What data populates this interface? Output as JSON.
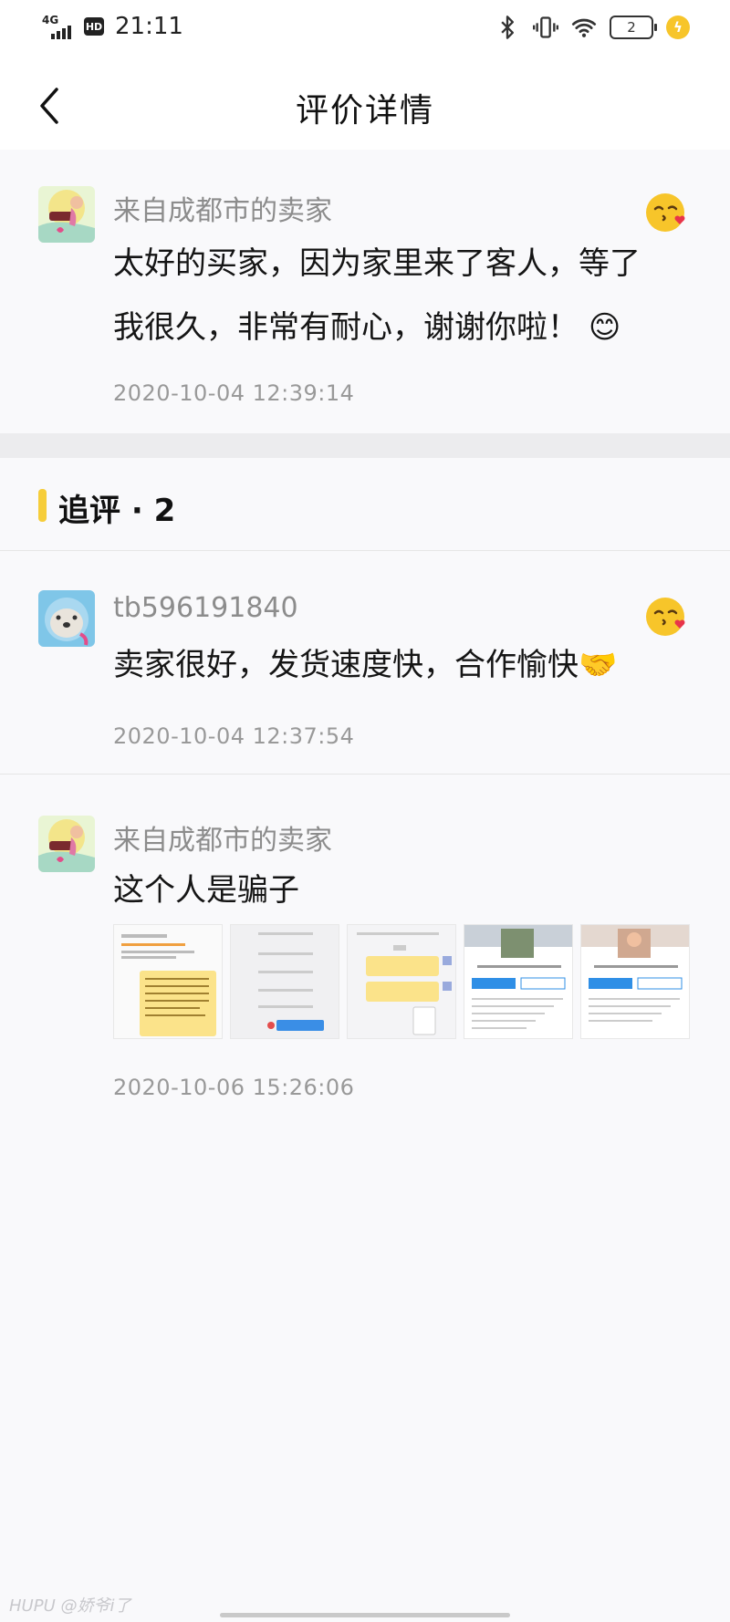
{
  "status_bar": {
    "network": "4G",
    "hd_label": "HD",
    "time": "21:11",
    "battery_level": "2",
    "icons": [
      "signal-icon",
      "bluetooth-icon",
      "vibrate-icon",
      "wifi-icon",
      "battery-icon",
      "charging-icon"
    ]
  },
  "header": {
    "back_icon": "chevron-left-icon",
    "title": "评价详情"
  },
  "main_review": {
    "author": "来自成都市的卖家",
    "content_line1": "太好的买家，因为家里来了客人，等了",
    "content_line2": "我很久，非常有耐心，谢谢你啦！",
    "content_emoji": "😊",
    "timestamp": "2020-10-04 12:39:14",
    "reaction_icon": "kiss-wink-emoji-icon"
  },
  "follow_up": {
    "title": "追评 · 2",
    "accent_color": "#f6cd3a",
    "items": [
      {
        "author": "tb596191840",
        "content": "卖家很好，发货速度快，合作愉快",
        "content_emoji": "🤝",
        "timestamp": "2020-10-04 12:37:54",
        "reaction_icon": "kiss-wink-emoji-icon"
      },
      {
        "author": "来自成都市的卖家",
        "content": "这个人是骗子",
        "timestamp": "2020-10-06 15:26:06",
        "image_count": 5
      }
    ]
  },
  "watermark": "HUPU @娇爷i了",
  "colors": {
    "page_bg": "#f9f9fb",
    "separator": "#ececee",
    "muted_text": "#8c8c8c",
    "accent": "#f6cd3a"
  }
}
